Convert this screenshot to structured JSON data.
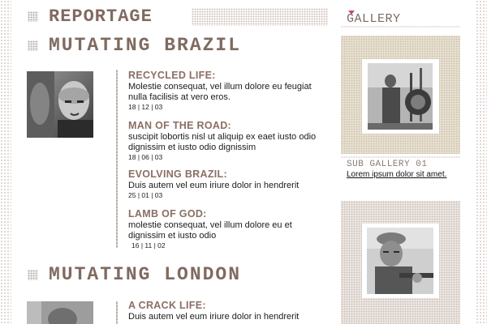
{
  "section": {
    "label": "REPORTAGE"
  },
  "stories": [
    {
      "title": "MUTATING BRAZIL",
      "articles": [
        {
          "title": "RECYCLED LIFE:",
          "body": "Molestie consequat, vel illum dolore eu feugiat nulla facilisis at vero eros.",
          "date": "18 | 12 | 03"
        },
        {
          "title": "MAN OF THE ROAD:",
          "body": "suscipit lobortis nisl ut aliquip ex eaet iusto odio dignissim et iusto odio dignissim",
          "date": "18 | 06 | 03"
        },
        {
          "title": "EVOLVING BRAZIL:",
          "body": "Duis autem vel eum iriure dolor in hendrerit",
          "date": "25 | 01 | 03"
        },
        {
          "title": "LAMB OF GOD:",
          "body": "molestie consequat, vel illum dolore eu et dignissim et iusto odio",
          "date": "16 | 11 | 02"
        }
      ]
    },
    {
      "title": "MUTATING LONDON",
      "articles": [
        {
          "title": "A CRACK LIFE:",
          "body": "Duis autem vel eum iriure dolor in hendrerit"
        }
      ]
    }
  ],
  "sidebar": {
    "title": "GALLERY",
    "sub_gallery": {
      "title": "SUB GALLERY 01",
      "link": "Lorem ipsum dolor sit amet."
    }
  },
  "colors": {
    "heading": "#806a60",
    "article_title": "#8a6f64",
    "bullet_arrow": "#c64a67",
    "gallery_tint": "#efe9d2",
    "dots": "#cfc2b9"
  }
}
